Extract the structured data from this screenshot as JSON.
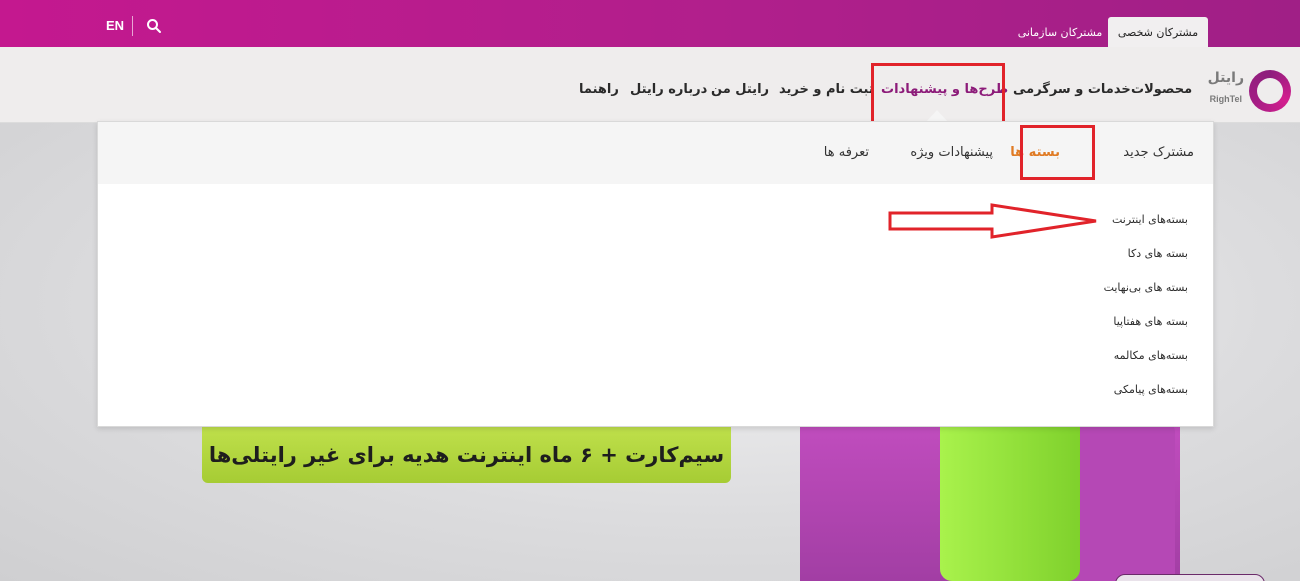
{
  "topbar": {
    "lang_label": "EN",
    "tabs": [
      {
        "label": "مشترکان شخصی",
        "active": true
      },
      {
        "label": "مشترکان سازمانی",
        "active": false
      }
    ]
  },
  "brand": {
    "name_fa": "رایتل",
    "name_en": "RighTel",
    "colors": {
      "primary": "#b11f8c",
      "accent": "#e07b24",
      "promo": "#a6cc34",
      "highlight": "#e1232a"
    }
  },
  "nav": {
    "items": [
      {
        "label": "محصولات"
      },
      {
        "label": "خدمات و سرگرمی"
      },
      {
        "label": "طرح‌ها و پیشنهادات",
        "active": true
      },
      {
        "label": "ثبت نام و خرید"
      },
      {
        "label": "رایتل من"
      },
      {
        "label": "درباره رایتل"
      },
      {
        "label": "راهنما"
      }
    ]
  },
  "dropdown": {
    "subnav": [
      {
        "label": "مشترک جدید"
      },
      {
        "label": "بسته ها",
        "active": true
      },
      {
        "label": "پیشنهادات ویژه"
      },
      {
        "label": "تعرفه ها"
      }
    ],
    "list": [
      {
        "label": "بسته‌های اینترنت"
      },
      {
        "label": "بسته های دکا"
      },
      {
        "label": "بسته های بی‌نهایت"
      },
      {
        "label": "بسته های هفتاپیا"
      },
      {
        "label": "بسته‌های مکالمه"
      },
      {
        "label": "بسته‌های پیامکی"
      }
    ]
  },
  "promo": {
    "text": "سیم‌کارت + ۶ ماه اینترنت هدیه برای غیر رایتلی‌ها"
  }
}
